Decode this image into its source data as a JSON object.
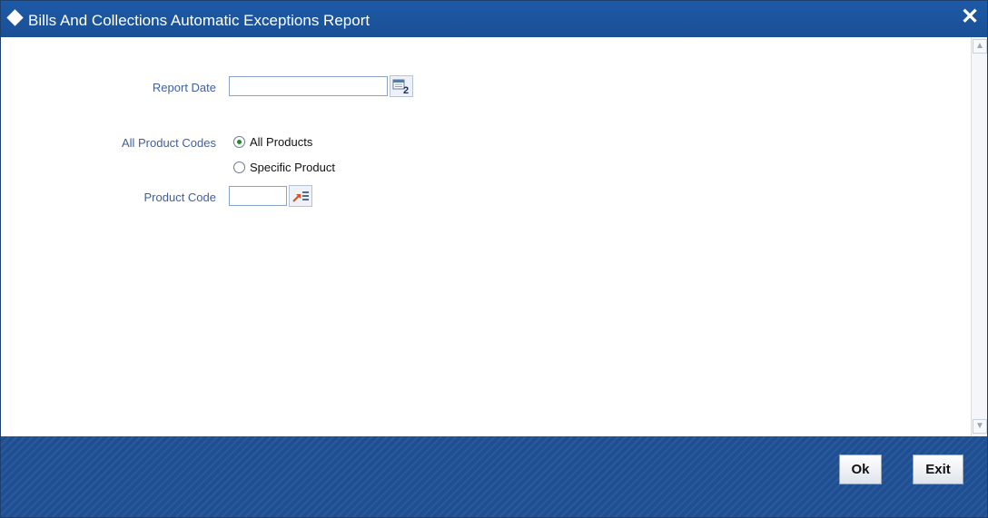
{
  "window": {
    "title": "Bills And Collections Automatic Exceptions Report",
    "close_glyph": "✕"
  },
  "form": {
    "report_date_label": "Report Date",
    "report_date_value": "",
    "all_product_codes_label": "All Product Codes",
    "options": [
      {
        "label": "All Products",
        "selected": true
      },
      {
        "label": "Specific Product",
        "selected": false
      }
    ],
    "product_code_label": "Product Code",
    "product_code_value": ""
  },
  "buttons": {
    "ok": "Ok",
    "exit": "Exit"
  },
  "icons": {
    "calendar": "calendar-icon",
    "lov": "list-of-values-icon"
  },
  "colors": {
    "title_bar": "#1d5aa8",
    "footer": "#1e4f93",
    "label": "#3f5f9f"
  }
}
